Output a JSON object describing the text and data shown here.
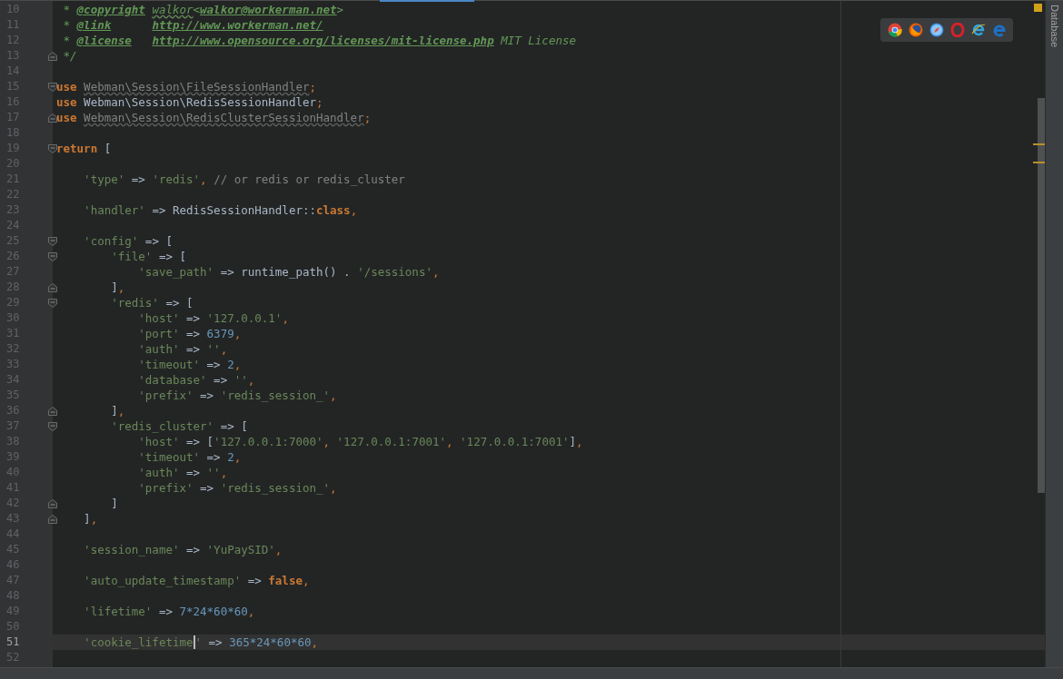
{
  "editor": {
    "lines": [
      {
        "number": "10",
        "current": false,
        "tokens": [
          {
            "kind": "comment",
            "text": " * "
          },
          {
            "kind": "doctag",
            "text": "@copyright"
          },
          {
            "kind": "typo",
            "text": "walkor"
          },
          {
            "kind": "comment",
            "text": "<"
          },
          {
            "kind": "doc",
            "text": "walkor@workerman.net"
          },
          {
            "kind": "comment",
            "text": ">"
          }
        ]
      },
      {
        "number": "11",
        "current": false,
        "tokens": [
          {
            "kind": "comment",
            "text": " * "
          },
          {
            "kind": "doctag",
            "text": "@link"
          },
          {
            "kind": "doc",
            "text": "http://www.workerman.net/"
          }
        ]
      },
      {
        "number": "12",
        "current": false,
        "tokens": [
          {
            "kind": "comment",
            "text": " * "
          },
          {
            "kind": "doctag",
            "text": "@license"
          },
          {
            "kind": "doc",
            "text": "http://www.opensource.org/licenses/mit-license.php"
          },
          {
            "kind": "comment",
            "text": " MIT License"
          }
        ]
      },
      {
        "number": "13",
        "current": false,
        "fold": {
          "kind": "end"
        },
        "tokens": [
          {
            "kind": "comment",
            "text": " */"
          }
        ]
      },
      {
        "number": "14",
        "current": false
      },
      {
        "number": "15",
        "current": false,
        "fold": {
          "kind": "start"
        },
        "tokens": [
          {
            "kind": "keyword",
            "text": "use "
          },
          {
            "kind": "unused",
            "text": "Webman\\Session\\FileSessionHandler"
          },
          {
            "kind": "punct",
            "text": ";"
          }
        ]
      },
      {
        "number": "16",
        "current": false,
        "tokens": [
          {
            "kind": "keyword",
            "text": "use "
          },
          {
            "kind": "plain",
            "text": "Webman\\Session\\RedisSessionHandler"
          },
          {
            "kind": "punct",
            "text": ";"
          }
        ]
      },
      {
        "number": "17",
        "current": false,
        "fold": {
          "kind": "end"
        },
        "tokens": [
          {
            "kind": "keyword",
            "text": "use "
          },
          {
            "kind": "unused",
            "text": "Webman\\Session\\RedisClusterSessionHandler"
          },
          {
            "kind": "punct",
            "text": ";"
          }
        ]
      },
      {
        "number": "18",
        "current": false
      },
      {
        "number": "19",
        "current": false,
        "fold": {
          "kind": "start"
        },
        "tokens": [
          {
            "kind": "keyword",
            "text": "return "
          },
          {
            "kind": "plain",
            "text": "["
          }
        ]
      },
      {
        "number": "20",
        "current": false
      },
      {
        "number": "21",
        "current": false,
        "tokens": [
          {
            "kind": "string",
            "text": "    'type'"
          },
          {
            "kind": "plain",
            "text": " => "
          },
          {
            "kind": "string",
            "text": "'redis'"
          },
          {
            "kind": "punct",
            "text": ","
          },
          {
            "kind": "linecomment",
            "text": " // or redis or redis_cluster"
          }
        ]
      },
      {
        "number": "22",
        "current": false
      },
      {
        "number": "23",
        "current": false,
        "tokens": [
          {
            "kind": "string",
            "text": "    'handler'"
          },
          {
            "kind": "plain",
            "text": " => RedisSessionHandler::"
          },
          {
            "kind": "keyword",
            "text": "class"
          },
          {
            "kind": "punct",
            "text": ","
          }
        ]
      },
      {
        "number": "24",
        "current": false
      },
      {
        "number": "25",
        "current": false,
        "fold": {
          "kind": "start"
        },
        "tokens": [
          {
            "kind": "string",
            "text": "    'config'"
          },
          {
            "kind": "plain",
            "text": " => ["
          }
        ]
      },
      {
        "number": "26",
        "current": false,
        "fold": {
          "kind": "start"
        },
        "tokens": [
          {
            "kind": "string",
            "text": "        'file'"
          },
          {
            "kind": "plain",
            "text": " => ["
          }
        ]
      },
      {
        "number": "27",
        "current": false,
        "tokens": [
          {
            "kind": "string",
            "text": "            'save_path'"
          },
          {
            "kind": "plain",
            "text": " => runtime_path() . "
          },
          {
            "kind": "string",
            "text": "'/sessions'"
          },
          {
            "kind": "punct",
            "text": ","
          }
        ]
      },
      {
        "number": "28",
        "current": false,
        "fold": {
          "kind": "end"
        },
        "tokens": [
          {
            "kind": "plain",
            "text": "        ]"
          },
          {
            "kind": "punct",
            "text": ","
          }
        ]
      },
      {
        "number": "29",
        "current": false,
        "fold": {
          "kind": "start"
        },
        "tokens": [
          {
            "kind": "string",
            "text": "        'redis'"
          },
          {
            "kind": "plain",
            "text": " => ["
          }
        ]
      },
      {
        "number": "30",
        "current": false,
        "tokens": [
          {
            "kind": "string",
            "text": "            'host'"
          },
          {
            "kind": "plain",
            "text": " => "
          },
          {
            "kind": "string",
            "text": "'127.0.0.1'"
          },
          {
            "kind": "punct",
            "text": ","
          }
        ]
      },
      {
        "number": "31",
        "current": false,
        "tokens": [
          {
            "kind": "string",
            "text": "            'port'"
          },
          {
            "kind": "plain",
            "text": " => "
          },
          {
            "kind": "number",
            "text": "6379"
          },
          {
            "kind": "punct",
            "text": ","
          }
        ]
      },
      {
        "number": "32",
        "current": false,
        "tokens": [
          {
            "kind": "string",
            "text": "            'auth'"
          },
          {
            "kind": "plain",
            "text": " => "
          },
          {
            "kind": "string",
            "text": "''"
          },
          {
            "kind": "punct",
            "text": ","
          }
        ]
      },
      {
        "number": "33",
        "current": false,
        "tokens": [
          {
            "kind": "string",
            "text": "            'timeout'"
          },
          {
            "kind": "plain",
            "text": " => "
          },
          {
            "kind": "number",
            "text": "2"
          },
          {
            "kind": "punct",
            "text": ","
          }
        ]
      },
      {
        "number": "34",
        "current": false,
        "tokens": [
          {
            "kind": "string",
            "text": "            'database'"
          },
          {
            "kind": "plain",
            "text": " => "
          },
          {
            "kind": "string",
            "text": "''"
          },
          {
            "kind": "punct",
            "text": ","
          }
        ]
      },
      {
        "number": "35",
        "current": false,
        "tokens": [
          {
            "kind": "string",
            "text": "            'prefix'"
          },
          {
            "kind": "plain",
            "text": " => "
          },
          {
            "kind": "string",
            "text": "'redis_session_'"
          },
          {
            "kind": "punct",
            "text": ","
          }
        ]
      },
      {
        "number": "36",
        "current": false,
        "fold": {
          "kind": "end"
        },
        "tokens": [
          {
            "kind": "plain",
            "text": "        ]"
          },
          {
            "kind": "punct",
            "text": ","
          }
        ]
      },
      {
        "number": "37",
        "current": false,
        "fold": {
          "kind": "start"
        },
        "tokens": [
          {
            "kind": "string",
            "text": "        'redis_cluster'"
          },
          {
            "kind": "plain",
            "text": " => ["
          }
        ]
      },
      {
        "number": "38",
        "current": false,
        "tokens": [
          {
            "kind": "string",
            "text": "            'host'"
          },
          {
            "kind": "plain",
            "text": " => ["
          },
          {
            "kind": "string",
            "text": "'127.0.0.1:7000'"
          },
          {
            "kind": "punct",
            "text": ", "
          },
          {
            "kind": "string",
            "text": "'127.0.0.1:7001'"
          },
          {
            "kind": "punct",
            "text": ", "
          },
          {
            "kind": "string",
            "text": "'127.0.0.1:7001'"
          },
          {
            "kind": "plain",
            "text": "]"
          },
          {
            "kind": "punct",
            "text": ","
          }
        ]
      },
      {
        "number": "39",
        "current": false,
        "tokens": [
          {
            "kind": "string",
            "text": "            'timeout'"
          },
          {
            "kind": "plain",
            "text": " => "
          },
          {
            "kind": "number",
            "text": "2"
          },
          {
            "kind": "punct",
            "text": ","
          }
        ]
      },
      {
        "number": "40",
        "current": false,
        "tokens": [
          {
            "kind": "string",
            "text": "            'auth'"
          },
          {
            "kind": "plain",
            "text": " => "
          },
          {
            "kind": "string",
            "text": "''"
          },
          {
            "kind": "punct",
            "text": ","
          }
        ]
      },
      {
        "number": "41",
        "current": false,
        "tokens": [
          {
            "kind": "string",
            "text": "            'prefix'"
          },
          {
            "kind": "plain",
            "text": " => "
          },
          {
            "kind": "string",
            "text": "'redis_session_'"
          },
          {
            "kind": "punct",
            "text": ","
          }
        ]
      },
      {
        "number": "42",
        "current": false,
        "fold": {
          "kind": "end"
        },
        "tokens": [
          {
            "kind": "plain",
            "text": "        ]"
          }
        ]
      },
      {
        "number": "43",
        "current": false,
        "fold": {
          "kind": "end"
        },
        "tokens": [
          {
            "kind": "plain",
            "text": "    ]"
          },
          {
            "kind": "punct",
            "text": ","
          }
        ]
      },
      {
        "number": "44",
        "current": false
      },
      {
        "number": "45",
        "current": false,
        "tokens": [
          {
            "kind": "string",
            "text": "    'session_name'"
          },
          {
            "kind": "plain",
            "text": " => "
          },
          {
            "kind": "string",
            "text": "'YuPaySID'"
          },
          {
            "kind": "punct",
            "text": ","
          }
        ]
      },
      {
        "number": "46",
        "current": false
      },
      {
        "number": "47",
        "current": false,
        "tokens": [
          {
            "kind": "string",
            "text": "    'auto_update_timestamp'"
          },
          {
            "kind": "plain",
            "text": " => "
          },
          {
            "kind": "keyword",
            "text": "false"
          },
          {
            "kind": "punct",
            "text": ","
          }
        ]
      },
      {
        "number": "48",
        "current": false
      },
      {
        "number": "49",
        "current": false,
        "tokens": [
          {
            "kind": "string",
            "text": "    'lifetime'"
          },
          {
            "kind": "plain",
            "text": " => "
          },
          {
            "kind": "number",
            "text": "7*24*60*60"
          },
          {
            "kind": "punct",
            "text": ","
          }
        ]
      },
      {
        "number": "50",
        "current": false
      },
      {
        "number": "51",
        "current": true,
        "tokens": [
          {
            "kind": "string",
            "text": "    'cookie_lifetime",
            "caret": true
          },
          {
            "kind": "string",
            "text": "'"
          },
          {
            "kind": "plain",
            "text": " => "
          },
          {
            "kind": "number",
            "text": "365*24*60*60"
          },
          {
            "kind": "punct",
            "text": ","
          }
        ]
      },
      {
        "number": "52",
        "current": false
      }
    ]
  },
  "side_panel": {
    "label": "Database"
  }
}
